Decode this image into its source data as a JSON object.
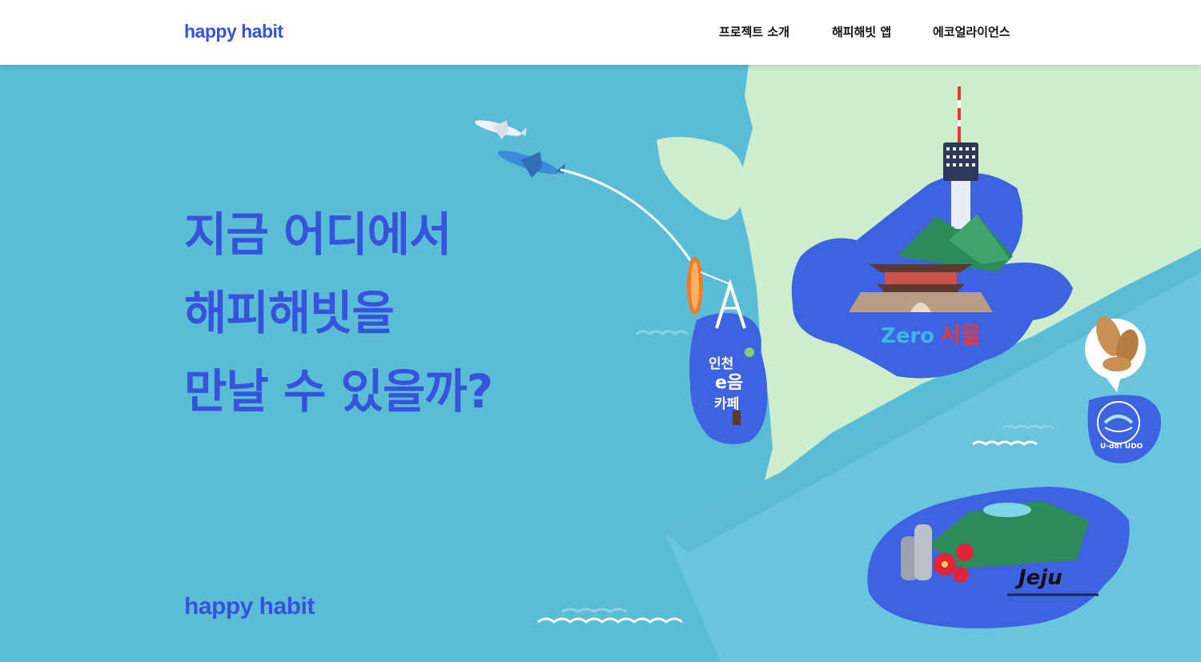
{
  "header": {
    "logo": "happy habit",
    "nav": [
      {
        "label": "프로젝트 소개"
      },
      {
        "label": "해피해빗 앱"
      },
      {
        "label": "에코얼라이언스"
      }
    ]
  },
  "hero": {
    "headline_lines": [
      "지금 어디에서",
      "해피해빗을",
      "만날 수 있을까?"
    ],
    "footer_logo": "happy habit"
  },
  "map": {
    "incheon": {
      "line1": "인천",
      "line2": "e음",
      "line3": "카페"
    },
    "seoul": {
      "zero": "Zero",
      "city": "서울"
    },
    "udo": {
      "label": "U-do! UDO"
    },
    "jeju": {
      "label": "Jeju"
    }
  },
  "colors": {
    "brand_blue": "#3553db",
    "sea": "#5bbcd6",
    "land": "#cdeecd",
    "island": "#3e63e0"
  }
}
